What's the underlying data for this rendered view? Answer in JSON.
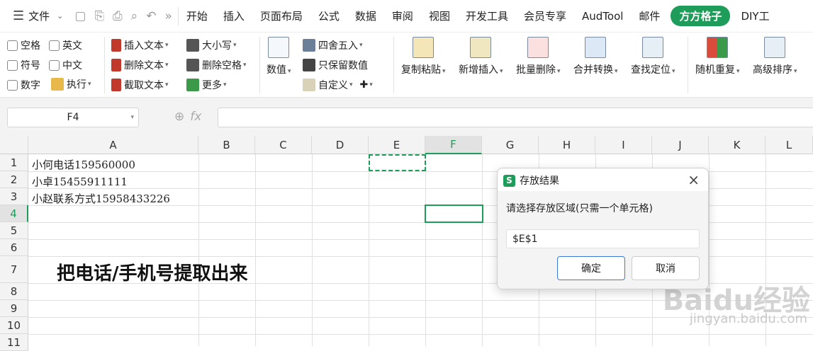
{
  "menubar": {
    "file_label": "文件",
    "tabs": [
      "开始",
      "插入",
      "页面布局",
      "公式",
      "数据",
      "审阅",
      "视图",
      "开发工具",
      "会员专享",
      "AudTool",
      "邮件",
      "方方格子",
      "DIY工"
    ],
    "active_tab": "方方格子"
  },
  "ribbon": {
    "checks": [
      "空格",
      "英文",
      "符号",
      "中文",
      "数字"
    ],
    "execute": "执行",
    "insert_text": "插入文本",
    "delete_text": "删除文本",
    "extract_text": "截取文本",
    "case": "大小写",
    "delete_space": "删除空格",
    "more": "更多",
    "value": "数值",
    "round": "四舍五入",
    "keep_value": "只保留数值",
    "custom": "自定义",
    "copy_paste": "复制粘贴",
    "new_insert": "新增插入",
    "batch_delete": "批量删除",
    "merge_convert": "合并转换",
    "find_locate": "查找定位",
    "random_repeat": "随机重复",
    "adv_sort": "高级排序"
  },
  "formula_bar": {
    "cell_ref": "F4",
    "content": ""
  },
  "sheet": {
    "columns": [
      "A",
      "B",
      "C",
      "D",
      "E",
      "F",
      "G",
      "H",
      "I",
      "J",
      "K",
      "L"
    ],
    "selected_column": "F",
    "rows": [
      "1",
      "2",
      "3",
      "4",
      "5",
      "6",
      "7",
      "8",
      "9",
      "10",
      "11"
    ],
    "selected_row": "4",
    "cells": {
      "A1": "小何电话159560000",
      "A2": "小卓15455911111",
      "A3": "小赵联系方式15958433226",
      "A7": "把电话/手机号提取出来"
    }
  },
  "dialog": {
    "title": "存放结果",
    "prompt": "请选择存放区域(只需一个单元格)",
    "value": "$E$1",
    "ok": "确定",
    "cancel": "取消"
  },
  "watermark": {
    "brand": "Baidu经验",
    "url": "jingyan.baidu.com"
  }
}
